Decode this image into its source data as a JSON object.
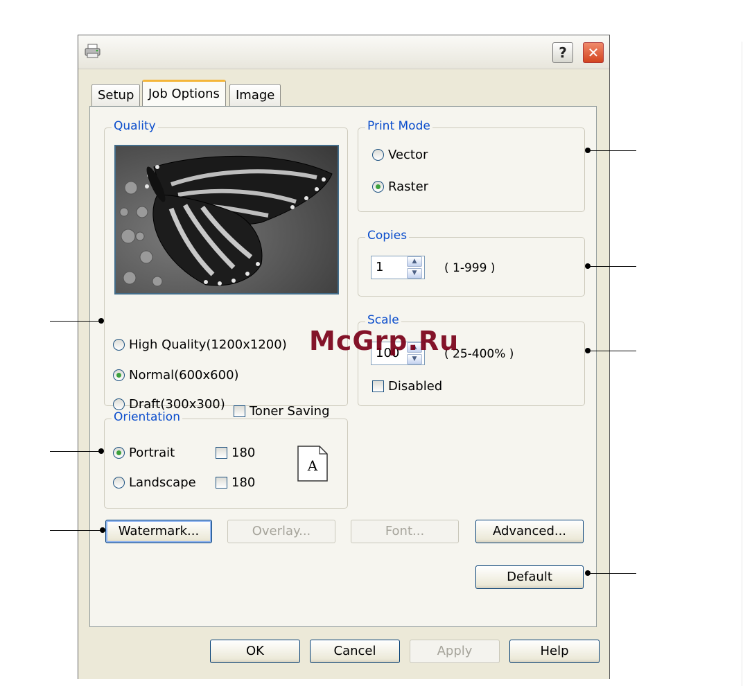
{
  "window": {
    "help_label": "?",
    "close_label": "✕",
    "icon": "printer-icon"
  },
  "tabs": [
    {
      "label": "Setup",
      "active": false
    },
    {
      "label": "Job Options",
      "active": true
    },
    {
      "label": "Image",
      "active": false
    }
  ],
  "quality": {
    "legend": "Quality",
    "options": [
      {
        "label": "High Quality(1200x1200)",
        "checked": false
      },
      {
        "label": "Normal(600x600)",
        "checked": true
      },
      {
        "label": "Draft(300x300)",
        "checked": false
      }
    ],
    "toner_saving": {
      "label": "Toner Saving",
      "checked": false
    },
    "preview_image": "butterfly-preview"
  },
  "orientation": {
    "legend": "Orientation",
    "portrait": {
      "label": "Portrait",
      "checked": true
    },
    "landscape": {
      "label": "Landscape",
      "checked": false
    },
    "portrait_180": {
      "label": "180",
      "checked": false
    },
    "landscape_180": {
      "label": "180",
      "checked": false
    },
    "page_icon_letter": "A"
  },
  "print_mode": {
    "legend": "Print Mode",
    "vector": {
      "label": "Vector",
      "checked": false
    },
    "raster": {
      "label": "Raster",
      "checked": true
    }
  },
  "copies": {
    "legend": "Copies",
    "value": "1",
    "range": "( 1-999 )"
  },
  "scale": {
    "legend": "Scale",
    "value": "100",
    "range": "( 25-400% )",
    "disabled": {
      "label": "Disabled",
      "checked": false
    }
  },
  "buttons": {
    "watermark": "Watermark...",
    "overlay": "Overlay...",
    "font": "Font...",
    "advanced": "Advanced...",
    "default": "Default"
  },
  "footer": {
    "ok": "OK",
    "cancel": "Cancel",
    "apply": "Apply",
    "help": "Help"
  },
  "overlay_watermark": "McGrp.Ru",
  "colors": {
    "legend_blue": "#0b4dcc",
    "dialog_bg": "#ece9d8",
    "active_tab_accent": "#f4b63a",
    "radio_dot": "#3ca03c"
  }
}
